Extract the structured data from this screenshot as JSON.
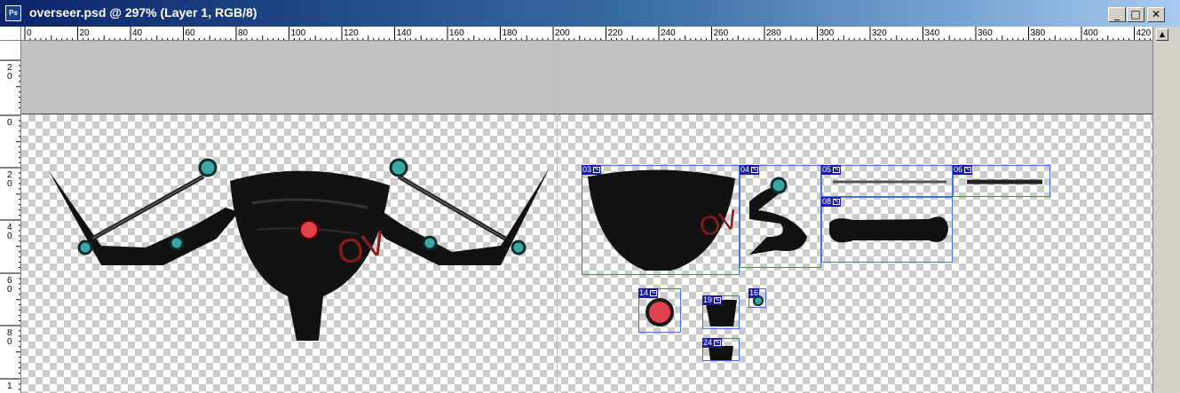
{
  "window": {
    "title": "overseer.psd @ 297% (Layer 1, RGB/8)",
    "app_icon_text": "Ps",
    "minimize_glyph": "_",
    "restore_glyph": "□",
    "close_glyph": "✕"
  },
  "ruler": {
    "horizontal_labels": [
      "0",
      "20",
      "40",
      "60",
      "80",
      "100",
      "120",
      "140",
      "160",
      "180",
      "200",
      "220",
      "240",
      "260",
      "280",
      "300",
      "320",
      "340",
      "360",
      "380",
      "400",
      "420"
    ],
    "vertical_labels": [
      "2 0",
      "0",
      "2 0",
      "4 0",
      "6 0",
      "8 0",
      "1"
    ]
  },
  "slices": [
    {
      "label": "03"
    },
    {
      "label": "04"
    },
    {
      "label": "05"
    },
    {
      "label": "06"
    },
    {
      "label": "08"
    },
    {
      "label": "14"
    },
    {
      "label": "19"
    },
    {
      "label": "16"
    },
    {
      "label": "24"
    }
  ],
  "artwork": {
    "text": "OV",
    "text_color": "#b22222",
    "accent_colors": {
      "orb_teal": "#3aa6a6",
      "orb_red": "#e0414a",
      "body": "#111111"
    }
  },
  "icons": {
    "app": "photoshop-document-icon",
    "slice_badge": "slice-image-icon",
    "minimize": "minimize-icon",
    "restore": "restore-icon",
    "close": "close-icon"
  }
}
